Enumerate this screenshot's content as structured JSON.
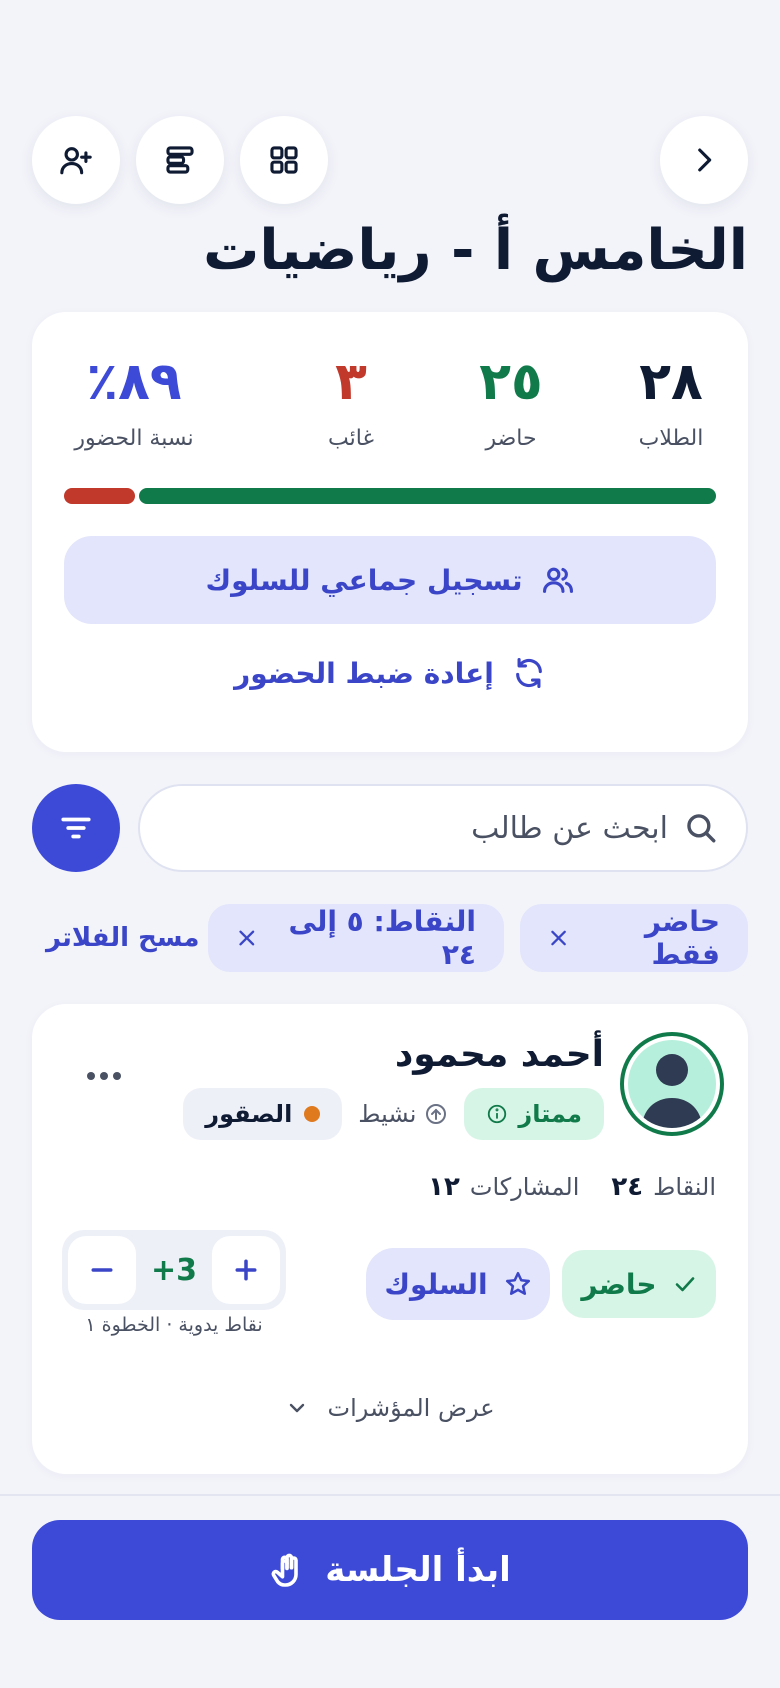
{
  "header": {
    "title": "الخامس أ - رياضيات",
    "icons": {
      "back": "chevron-right-icon",
      "grid": "grid-icon",
      "list": "list-icon",
      "add_user": "user-plus-icon"
    }
  },
  "stats": {
    "students": {
      "value": "٢٨",
      "label": "الطلاب"
    },
    "present": {
      "value": "٢٥",
      "label": "حاضر"
    },
    "absent": {
      "value": "٣",
      "label": "غائب"
    },
    "rate": {
      "value": "٨٩٪",
      "label": "نسبة الحضور"
    },
    "attendance_bar": {
      "present_fraction": 0.89,
      "absent_fraction": 0.11
    },
    "bulk_behavior_label": "تسجيل جماعي للسلوك",
    "reset_attendance_label": "إعادة ضبط الحضور"
  },
  "search": {
    "placeholder": "ابحث عن طالب",
    "value": ""
  },
  "filters": {
    "chips": [
      {
        "label": "حاضر فقط"
      },
      {
        "label": "النقاط: ٥ إلى ٢٤"
      }
    ],
    "clear_label": "مسح الفلاتر"
  },
  "student": {
    "name": "أحمد محمود",
    "badge_level": "ممتاز",
    "badge_activity": "نشيط",
    "team": "الصقور",
    "points_label": "النقاط",
    "points_value": "٢٤",
    "participations_label": "المشاركات",
    "participations_value": "١٢",
    "attendance_button": "حاضر",
    "behavior_button": "السلوك",
    "stepper_value": "+3",
    "stepper_hint": "نقاط يدوية · الخطوة ١",
    "show_indicators": "عرض المؤشرات"
  },
  "footer": {
    "start_label": "ابدأ الجلسة"
  },
  "colors": {
    "accent": "#3d4ad8",
    "present": "#117a4a",
    "absent": "#c0392b",
    "team_dot": "#e07a1f"
  }
}
